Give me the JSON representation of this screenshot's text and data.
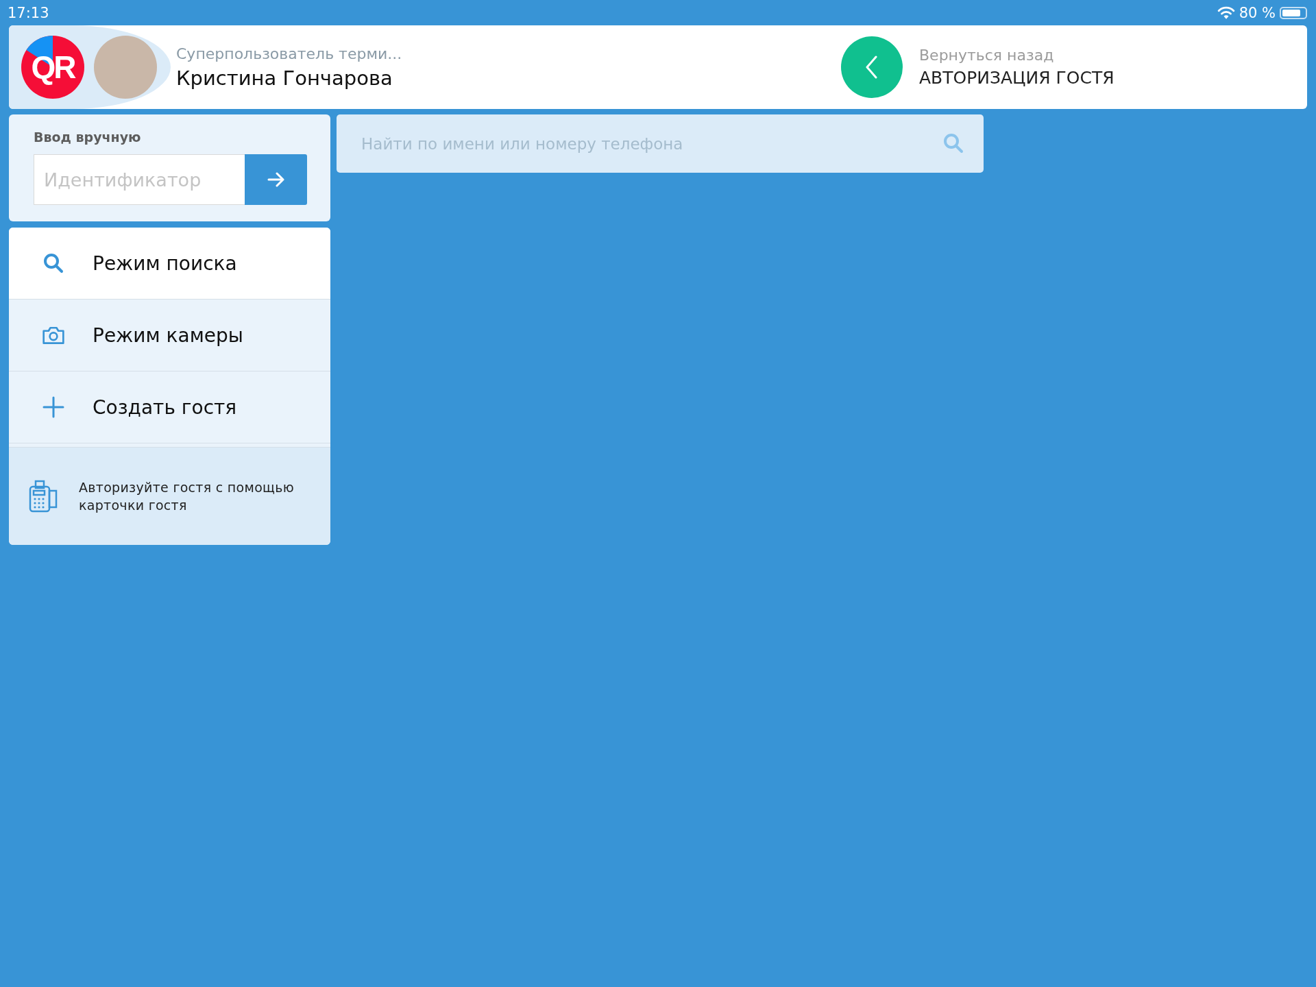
{
  "status_bar": {
    "time": "17:13",
    "battery_text": "80 %"
  },
  "header": {
    "logo_text": "QR",
    "user_role": "Суперпользователь терми...",
    "user_name": "Кристина Гончарова",
    "back_label": "Вернуться назад",
    "screen_title": "АВТОРИЗАЦИЯ ГОСТЯ"
  },
  "manual_entry": {
    "title": "Ввод вручную",
    "placeholder": "Идентификатор"
  },
  "modes": [
    {
      "kind": "search",
      "label": "Режим поиска",
      "selected": true
    },
    {
      "kind": "camera",
      "label": "Режим камеры",
      "selected": false
    },
    {
      "kind": "create",
      "label": "Создать гостя",
      "selected": false
    }
  ],
  "hint": "Авторизуйте гостя с помощью карточки гостя",
  "search": {
    "placeholder": "Найти по имени или номеру телефона"
  }
}
